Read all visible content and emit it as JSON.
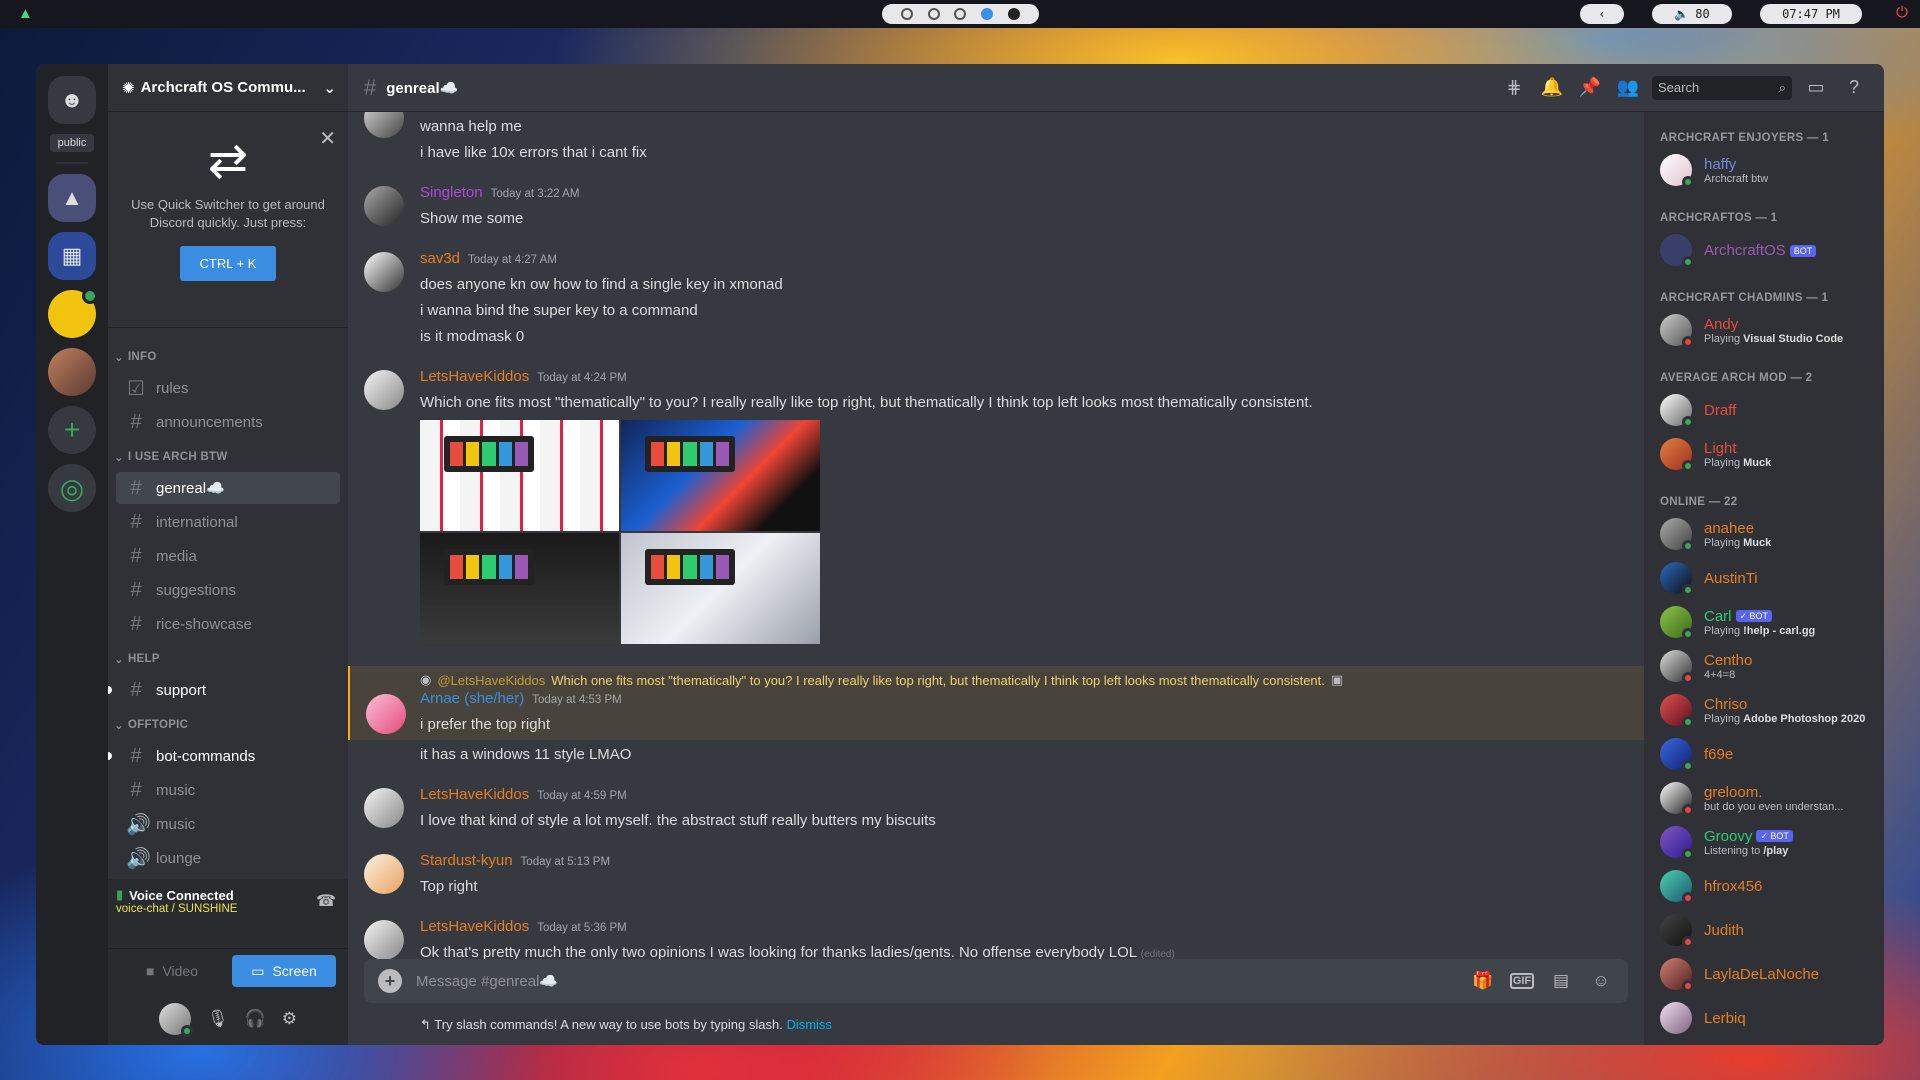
{
  "topbar": {
    "logo_icon": "archcraft-logo-icon",
    "volume": "80",
    "clock": "07:47 PM",
    "back_glyph": "‹"
  },
  "guilds": {
    "public_label": "public"
  },
  "server": {
    "name": "Archcraft OS Commu..."
  },
  "quick_switcher": {
    "text": "Use Quick Switcher to get around Discord quickly. Just press:",
    "button": "CTRL + K"
  },
  "categories": [
    {
      "name": "INFO",
      "channels": [
        {
          "name": "rules",
          "icon": "rules-icon"
        },
        {
          "name": "announcements",
          "icon": "hash-icon"
        }
      ]
    },
    {
      "name": "I USE ARCH BTW",
      "channels": [
        {
          "name": "genreal☁️"
        },
        {
          "name": "international"
        },
        {
          "name": "media"
        },
        {
          "name": "suggestions"
        },
        {
          "name": "rice-showcase"
        }
      ]
    },
    {
      "name": "HELP",
      "channels": [
        {
          "name": "support"
        }
      ]
    },
    {
      "name": "OFFTOPIC",
      "channels": [
        {
          "name": "bot-commands"
        },
        {
          "name": "music"
        },
        {
          "name": "music"
        },
        {
          "name": "lounge"
        }
      ]
    }
  ],
  "voice": {
    "title": "Voice Connected",
    "channel": "voice-chat / SUNSHINE",
    "video": "Video",
    "screen": "Screen"
  },
  "channel_header": {
    "name": "genreal☁️",
    "search_placeholder": "Search"
  },
  "messages": [
    {
      "lines": [
        "wanna help me",
        "i have like 10x errors that i cant fix"
      ]
    },
    {
      "author": "Singleton",
      "time": "Today at 3:22 AM",
      "lines": [
        "Show me some"
      ]
    },
    {
      "author": "sav3d",
      "time": "Today at 4:27 AM",
      "lines": [
        "does anyone kn ow how to find a single key in xmonad",
        "i wanna bind the super key to a command",
        "is it modmask 0"
      ]
    },
    {
      "author": "LetsHaveKiddos",
      "time": "Today at 4:24 PM",
      "lines": [
        "Which one fits most \"thematically\" to you? I really really like top right, but thematically I think top left looks most thematically consistent."
      ]
    },
    {
      "reply_author": "@LetsHaveKiddos",
      "reply_text": "Which one fits most \"thematically\" to you? I really really like top right, but thematically I think top left looks most thematically consistent.",
      "author": "Arnae (she/her)",
      "time": "Today at 4:53 PM",
      "lines": [
        "i prefer the top right",
        "it has a windows 11 style LMAO"
      ]
    },
    {
      "author": "LetsHaveKiddos",
      "time": "Today at 4:59 PM",
      "lines": [
        "I love that kind of style a lot myself. the abstract stuff really butters my biscuits"
      ]
    },
    {
      "author": "Stardust-kyun",
      "time": "Today at 5:13 PM",
      "lines": [
        "Top right"
      ]
    },
    {
      "author": "LetsHaveKiddos",
      "time": "Today at 5:36 PM",
      "lines": [
        "Ok that's pretty much the only two opinions I was looking for thanks ladies/gents. No offense everybody LOL"
      ],
      "edited": "(edited)"
    }
  ],
  "composer": {
    "placeholder": "Message #genreal☁️",
    "tip": "Try slash commands! A new way to use bots by typing slash.",
    "dismiss": "Dismiss"
  },
  "members": {
    "groups": [
      {
        "title": "ARCHCRAFT ENJOYERS — 1",
        "members": [
          {
            "name": "haffy",
            "activity": "Archcraft btw",
            "color": "#7289da"
          }
        ]
      },
      {
        "title": "ARCHCRAFTOS — 1",
        "members": [
          {
            "name": "ArchcraftOS",
            "badge": "BOT",
            "color": "#9b59b6"
          }
        ]
      },
      {
        "title": "ARCHCRAFT CHADMINS — 1",
        "members": [
          {
            "name": "Andy",
            "activity_prefix": "Playing",
            "activity": "Visual Studio Code",
            "color": "#e74c3c"
          }
        ]
      },
      {
        "title": "AVERAGE ARCH MOD — 2",
        "members": [
          {
            "name": "Draff",
            "color": "#e74c3c"
          },
          {
            "name": "Light",
            "activity_prefix": "Playing",
            "activity": "Muck",
            "color": "#e74c3c"
          }
        ]
      },
      {
        "title": "ONLINE — 22",
        "members": [
          {
            "name": "anahee",
            "activity_prefix": "Playing",
            "activity": "Muck",
            "color": "#e67e22"
          },
          {
            "name": "AustinTi",
            "color": "#e67e22"
          },
          {
            "name": "Carl",
            "badge": "✓ BOT",
            "activity_prefix": "Playing",
            "activity": "!help - carl.gg",
            "color": "#2ecc71"
          },
          {
            "name": "Centho",
            "activity": "4+4=8",
            "color": "#e67e22"
          },
          {
            "name": "Chriso",
            "activity_prefix": "Playing",
            "activity": "Adobe Photoshop 2020",
            "color": "#e67e22"
          },
          {
            "name": "f69e",
            "color": "#e67e22"
          },
          {
            "name": "greloom.",
            "activity": "but do you even understan...",
            "color": "#e67e22"
          },
          {
            "name": "Groovy",
            "badge": "✓ BOT",
            "activity_prefix": "Listening to",
            "activity": "/play",
            "color": "#2ecc71"
          },
          {
            "name": "hfrox456",
            "color": "#e67e22"
          },
          {
            "name": "Judith",
            "color": "#e67e22"
          },
          {
            "name": "LaylaDeLaNoche",
            "color": "#e67e22"
          },
          {
            "name": "Lerbiq",
            "color": "#e67e22"
          }
        ]
      }
    ]
  }
}
